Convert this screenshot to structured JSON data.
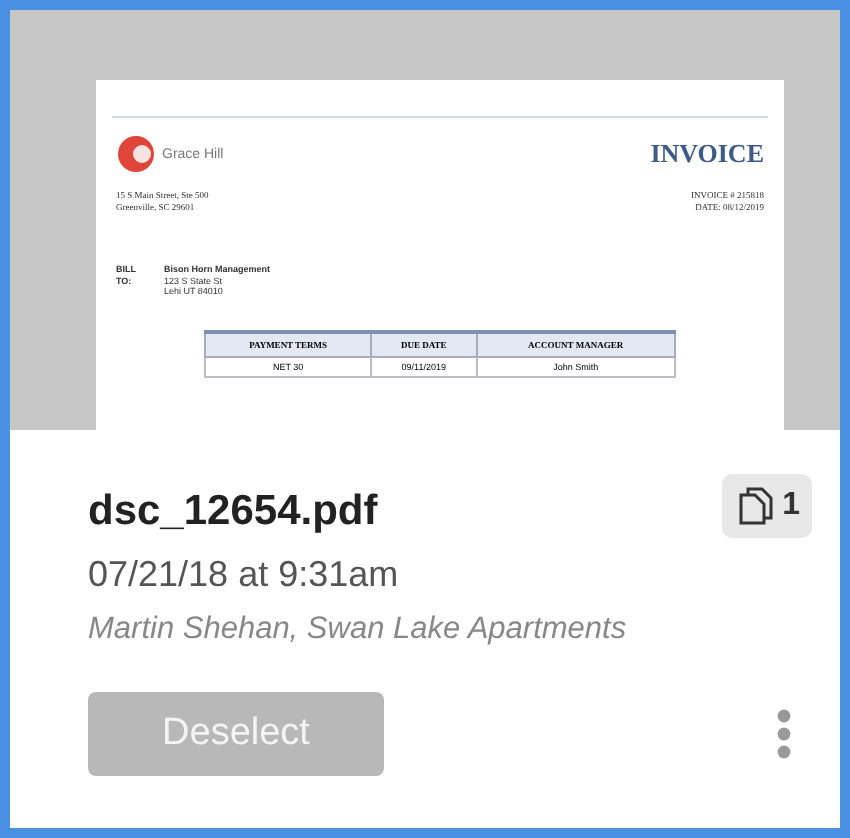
{
  "card": {
    "selected": true
  },
  "document": {
    "logo_text": "Grace Hill",
    "title": "INVOICE",
    "address": [
      "15 S Main Street, Ste 500",
      "Greenville, SC 29601"
    ],
    "invoice_number": "INVOICE # 215818",
    "date": "DATE: 08/12/2019",
    "bill_to_label": [
      "BILL",
      "TO:"
    ],
    "bill_to": [
      "Bison Horn Management",
      "123 S State St",
      "Lehi UT 84010"
    ],
    "table": {
      "columns": [
        "PAYMENT TERMS",
        "DUE DATE",
        "ACCOUNT MANAGER"
      ],
      "rows": [
        [
          "NET 30",
          "09/11/2019",
          "John Smith"
        ]
      ]
    }
  },
  "file": {
    "name": "dsc_12654.pdf",
    "page_count": "1",
    "date": "07/21/18 at 9:31am",
    "owner": "Martin Shehan, Swan Lake Apartments"
  },
  "button": {
    "label": "Deselect"
  }
}
